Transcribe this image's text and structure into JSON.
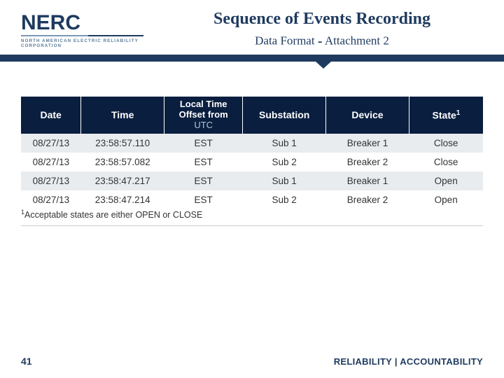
{
  "logo": {
    "main": "NERC",
    "sub": "NORTH AMERICAN ELECTRIC RELIABILITY CORPORATION"
  },
  "title": "Sequence of Events Recording",
  "subtitle_a": "Data Format",
  "subtitle_dash": "-",
  "subtitle_b": "Attachment 2",
  "table": {
    "headers": {
      "date": "Date",
      "time": "Time",
      "offset_a": "Local Time",
      "offset_b": "Offset from",
      "offset_c": "UTC",
      "substation": "Substation",
      "device": "Device",
      "state": "State",
      "state_sup": "1"
    },
    "rows": [
      {
        "date": "08/27/13",
        "time": "23:58:57.110",
        "offset": "EST",
        "substation": "Sub 1",
        "device": "Breaker 1",
        "state": "Close"
      },
      {
        "date": "08/27/13",
        "time": "23:58:57.082",
        "offset": "EST",
        "substation": "Sub 2",
        "device": "Breaker 2",
        "state": "Close"
      },
      {
        "date": "08/27/13",
        "time": "23:58:47.217",
        "offset": "EST",
        "substation": "Sub 1",
        "device": "Breaker 1",
        "state": "Open"
      },
      {
        "date": "08/27/13",
        "time": "23:58:47.214",
        "offset": "EST",
        "substation": "Sub 2",
        "device": "Breaker 2",
        "state": "Open"
      }
    ]
  },
  "footnote_sup": "1",
  "footnote": "Acceptable states are either OPEN or CLOSE",
  "page_number": "41",
  "footer": {
    "a": "RELIABILITY",
    "sep": " | ",
    "b": "ACCOUNTABILITY"
  }
}
